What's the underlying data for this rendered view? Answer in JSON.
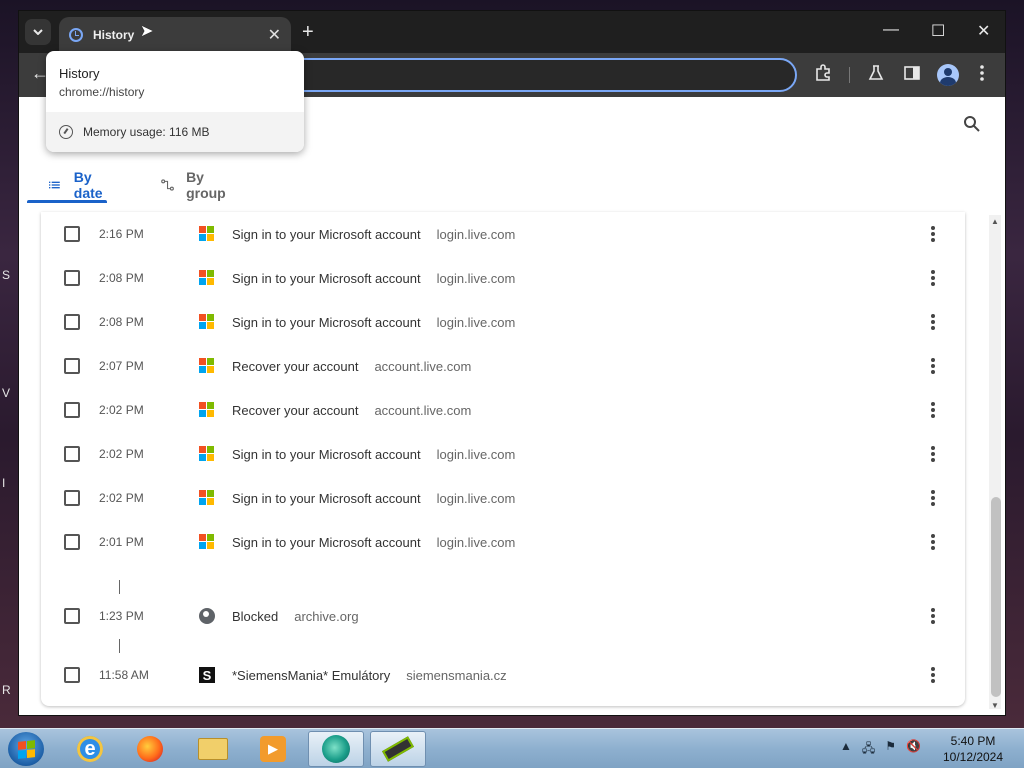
{
  "desktop": {
    "edge_letters": [
      "S",
      "V",
      "I",
      "R"
    ]
  },
  "browser": {
    "tab": {
      "title": "History",
      "icon": "history-icon"
    },
    "window_controls": {
      "minimize": "—",
      "maximize": "☐",
      "close": "✕"
    },
    "accent_color": "#1a62c9"
  },
  "hovercard": {
    "title": "History",
    "url": "chrome://history",
    "memory": "Memory usage: 116 MB"
  },
  "page": {
    "tabs": [
      {
        "label": "By date",
        "icon": "list-icon",
        "active": true
      },
      {
        "label": "By group",
        "icon": "group-icon",
        "active": false
      }
    ],
    "history": [
      {
        "time": "2:16 PM",
        "title": "Sign in to your Microsoft account",
        "domain": "login.live.com",
        "favicon": "microsoft-icon"
      },
      {
        "time": "2:08 PM",
        "title": "Sign in to your Microsoft account",
        "domain": "login.live.com",
        "favicon": "microsoft-icon"
      },
      {
        "time": "2:08 PM",
        "title": "Sign in to your Microsoft account",
        "domain": "login.live.com",
        "favicon": "microsoft-icon"
      },
      {
        "time": "2:07 PM",
        "title": "Recover your account",
        "domain": "account.live.com",
        "favicon": "microsoft-icon"
      },
      {
        "time": "2:02 PM",
        "title": "Recover your account",
        "domain": "account.live.com",
        "favicon": "microsoft-icon"
      },
      {
        "time": "2:02 PM",
        "title": "Sign in to your Microsoft account",
        "domain": "login.live.com",
        "favicon": "microsoft-icon"
      },
      {
        "time": "2:02 PM",
        "title": "Sign in to your Microsoft account",
        "domain": "login.live.com",
        "favicon": "microsoft-icon"
      },
      {
        "time": "2:01 PM",
        "title": "Sign in to your Microsoft account",
        "domain": "login.live.com",
        "favicon": "microsoft-icon"
      },
      {
        "time": "1:23 PM",
        "title": "Blocked",
        "domain": "archive.org",
        "favicon": "globe-icon"
      },
      {
        "time": "11:58 AM",
        "title": "*SiemensMania* Emulátory",
        "domain": "siemensmania.cz",
        "favicon": "siemensmania-icon"
      }
    ]
  },
  "taskbar": {
    "apps": [
      "internet-explorer-icon",
      "firefox-icon",
      "file-explorer-icon",
      "media-player-icon",
      "chrome-icon",
      "phone-app-icon"
    ],
    "clock": {
      "time": "5:40 PM",
      "date": "10/12/2024"
    }
  }
}
